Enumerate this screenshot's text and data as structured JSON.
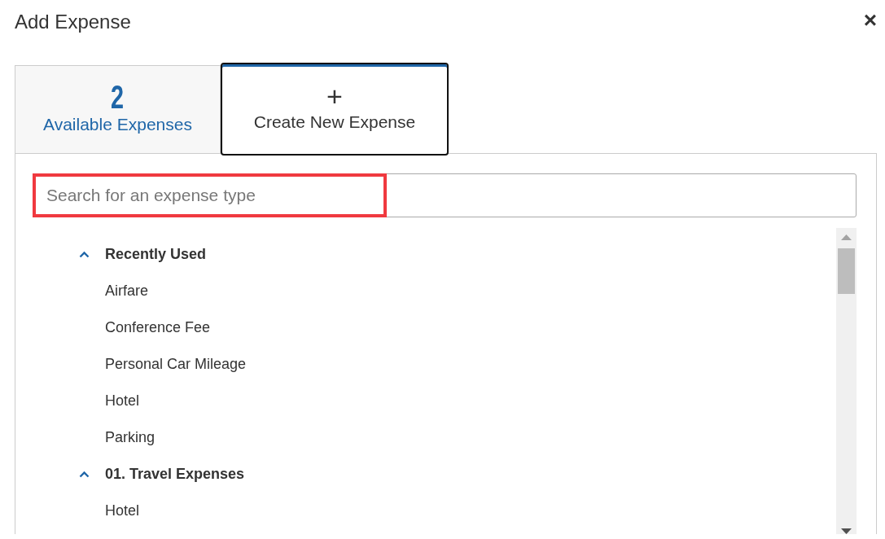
{
  "dialog": {
    "title": "Add Expense",
    "close": "×"
  },
  "tabs": [
    {
      "kind": "count",
      "count": "2",
      "label": "Available Expenses",
      "selected": false
    },
    {
      "kind": "create",
      "icon": "+",
      "label": "Create New Expense",
      "selected": true
    }
  ],
  "search": {
    "placeholder": "Search for an expense type",
    "highlighted": true
  },
  "groups": [
    {
      "label": "Recently Used",
      "expanded": true,
      "children": [
        {
          "label": "Airfare"
        },
        {
          "label": "Conference Fee"
        },
        {
          "label": "Personal Car Mileage"
        },
        {
          "label": "Hotel"
        },
        {
          "label": "Parking"
        }
      ]
    },
    {
      "label": "01. Travel Expenses",
      "expanded": true,
      "children": [
        {
          "label": "Hotel"
        }
      ]
    }
  ]
}
